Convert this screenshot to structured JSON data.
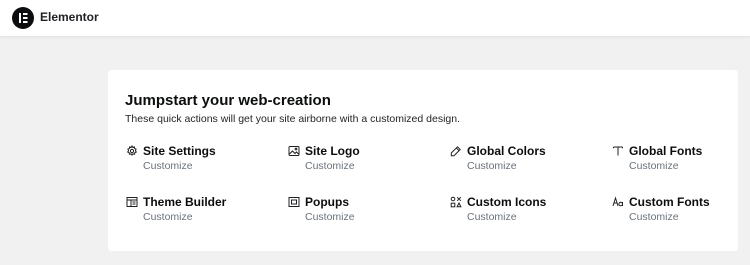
{
  "app": {
    "name": "Elementor",
    "logo_icon": "elementor-e-icon"
  },
  "panel": {
    "title": "Jumpstart your web-creation",
    "subtitle": "These quick actions will get your site airborne with a customized design."
  },
  "actions": [
    {
      "label": "Site Settings",
      "link": "Customize",
      "icon": "gear-icon"
    },
    {
      "label": "Site Logo",
      "link": "Customize",
      "icon": "image-icon"
    },
    {
      "label": "Global Colors",
      "link": "Customize",
      "icon": "eyedropper-icon"
    },
    {
      "label": "Global Fonts",
      "link": "Customize",
      "icon": "text-t-icon"
    },
    {
      "label": "Theme Builder",
      "link": "Customize",
      "icon": "layout-icon"
    },
    {
      "label": "Popups",
      "link": "Customize",
      "icon": "popup-icon"
    },
    {
      "label": "Custom Icons",
      "link": "Customize",
      "icon": "icons-grid-icon"
    },
    {
      "label": "Custom Fonts",
      "link": "Customize",
      "icon": "font-aa-icon"
    }
  ]
}
